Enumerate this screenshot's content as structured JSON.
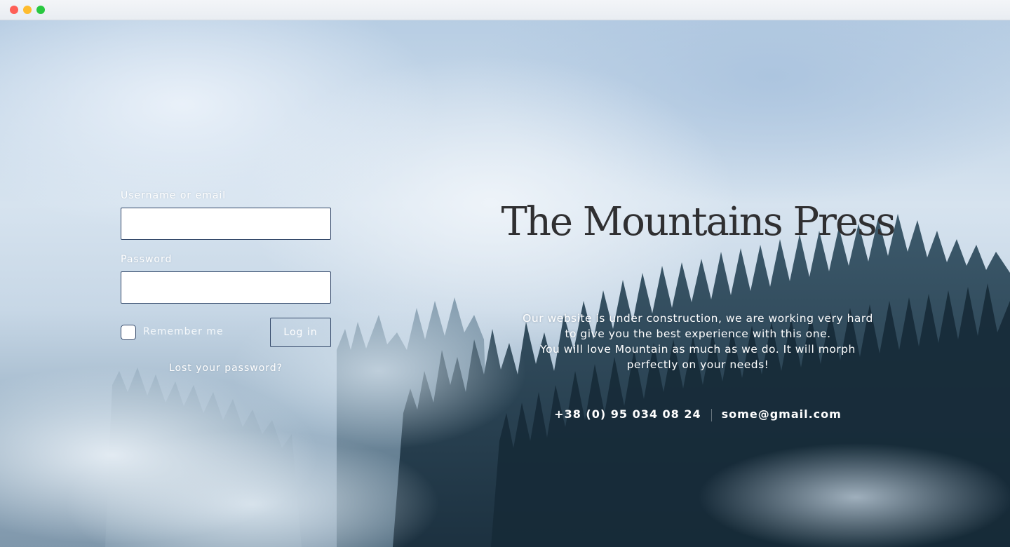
{
  "login_form": {
    "username_label": "Username or email",
    "username_value": "",
    "password_label": "Password",
    "password_value": "",
    "remember_label": "Remember me",
    "remember_checked": false,
    "login_button_label": "Log in",
    "lost_password_link": "Lost your password?"
  },
  "brand": {
    "title": "The Mountains Press"
  },
  "message": {
    "lines": [
      "Our website is under construction, we are working very hard",
      "to give you the best experience with this one.",
      "You will love Mountain as much as we do. It will morph",
      "perfectly on your needs!"
    ]
  },
  "contact": {
    "phone": "+38 (0) 95 034 08 24",
    "email": "some@gmail.com"
  },
  "colors": {
    "input_border": "#34496a",
    "title_text": "#2f2f31",
    "light_text": "#ffffff"
  }
}
